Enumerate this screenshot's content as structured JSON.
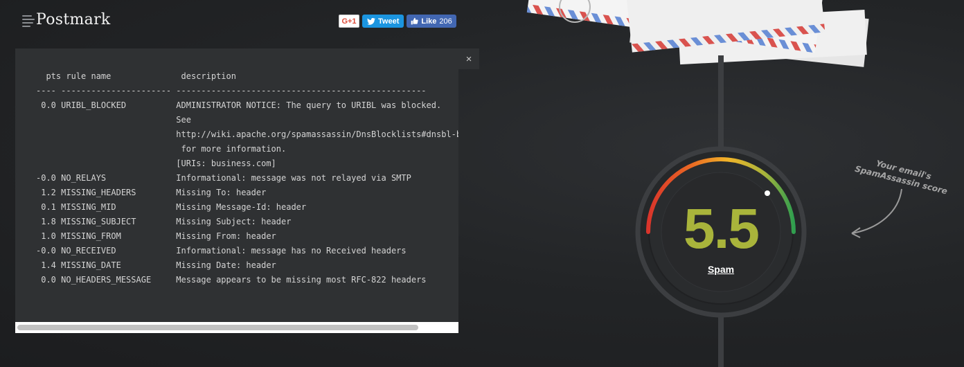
{
  "brand": {
    "name": "Postmark"
  },
  "social": {
    "gplus_label": "G+1",
    "tweet_label": "Tweet",
    "like_label": "Like",
    "like_count": "206"
  },
  "report": {
    "close_label": "×",
    "text": "  pts rule name              description\n---- ---------------------- --------------------------------------------------\n 0.0 URIBL_BLOCKED          ADMINISTRATOR NOTICE: The query to URIBL was blocked.\n                            See\n                            http://wiki.apache.org/spamassassin/DnsBlocklists#dnsbl-block\n                             for more information.\n                            [URIs: business.com]\n-0.0 NO_RELAYS              Informational: message was not relayed via SMTP\n 1.2 MISSING_HEADERS        Missing To: header\n 0.1 MISSING_MID            Missing Message-Id: header\n 1.8 MISSING_SUBJECT        Missing Subject: header\n 1.0 MISSING_FROM           Missing From: header\n-0.0 NO_RECEIVED            Informational: message has no Received headers\n 1.4 MISSING_DATE           Missing Date: header\n 0.0 NO_HEADERS_MESSAGE     Message appears to be missing most RFC-822 headers"
  },
  "score": {
    "value": "5.5",
    "label": "Spam",
    "gauge_fraction": 0.88,
    "color": "#a9b43b"
  },
  "annotation": {
    "line1": "Your email's",
    "line2": "SpamAssassin score"
  }
}
